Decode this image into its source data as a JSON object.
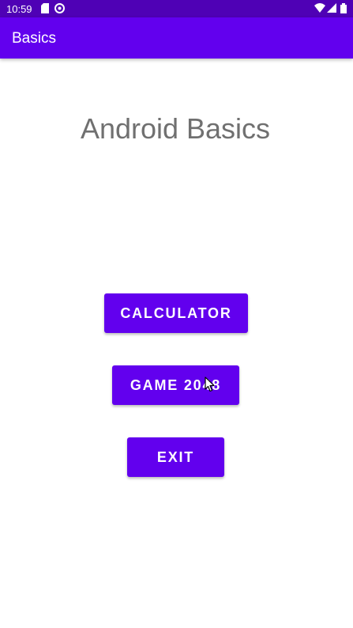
{
  "status_bar": {
    "time": "10:59",
    "icons": [
      "sd-card-icon",
      "sync-icon",
      "wifi-icon",
      "signal-icon",
      "battery-icon"
    ]
  },
  "app_bar": {
    "title": "Basics"
  },
  "main": {
    "heading": "Android Basics",
    "buttons": {
      "calculator": "CALCULATOR",
      "game": "GAME 2048",
      "exit": "EXIT"
    }
  },
  "colors": {
    "status_bar": "#4f01b5",
    "primary": "#6200ee",
    "heading_text": "#707070",
    "background": "#ffffff"
  }
}
